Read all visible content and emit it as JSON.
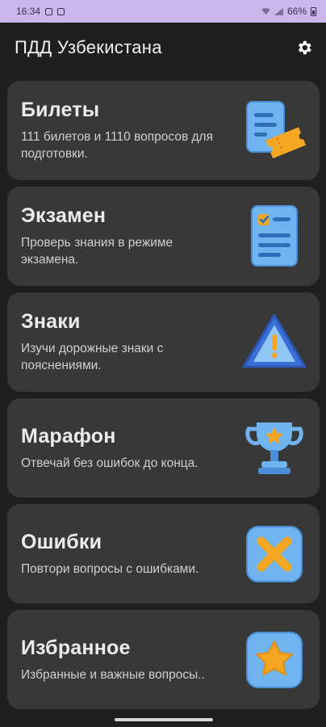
{
  "status_bar": {
    "time": "16:34",
    "battery": "66%"
  },
  "app_bar": {
    "title": "ПДД Узбекистана"
  },
  "cards": [
    {
      "title": "Билеты",
      "description": "111 билетов и 1110 вопросов для подготовки.",
      "icon": "ticket-icon"
    },
    {
      "title": "Экзамен",
      "description": "Проверь знания в режиме экзамена.",
      "icon": "exam-checklist-icon"
    },
    {
      "title": "Знаки",
      "description": "Изучи дорожные знаки с пояснениями.",
      "icon": "warning-sign-icon"
    },
    {
      "title": "Марафон",
      "description": "Отвечай без ошибок до конца.",
      "icon": "trophy-icon"
    },
    {
      "title": "Ошибки",
      "description": "Повтори вопросы с ошибками.",
      "icon": "cross-mark-icon"
    },
    {
      "title": "Избранное",
      "description": "Избранные и важные вопросы..",
      "icon": "star-icon"
    }
  ],
  "colors": {
    "status_bar_bg": "#cbb8ea",
    "background": "#1f1f1f",
    "card_bg": "#383838",
    "icon_blue": "#6fb4f0",
    "icon_orange": "#f5a623"
  }
}
